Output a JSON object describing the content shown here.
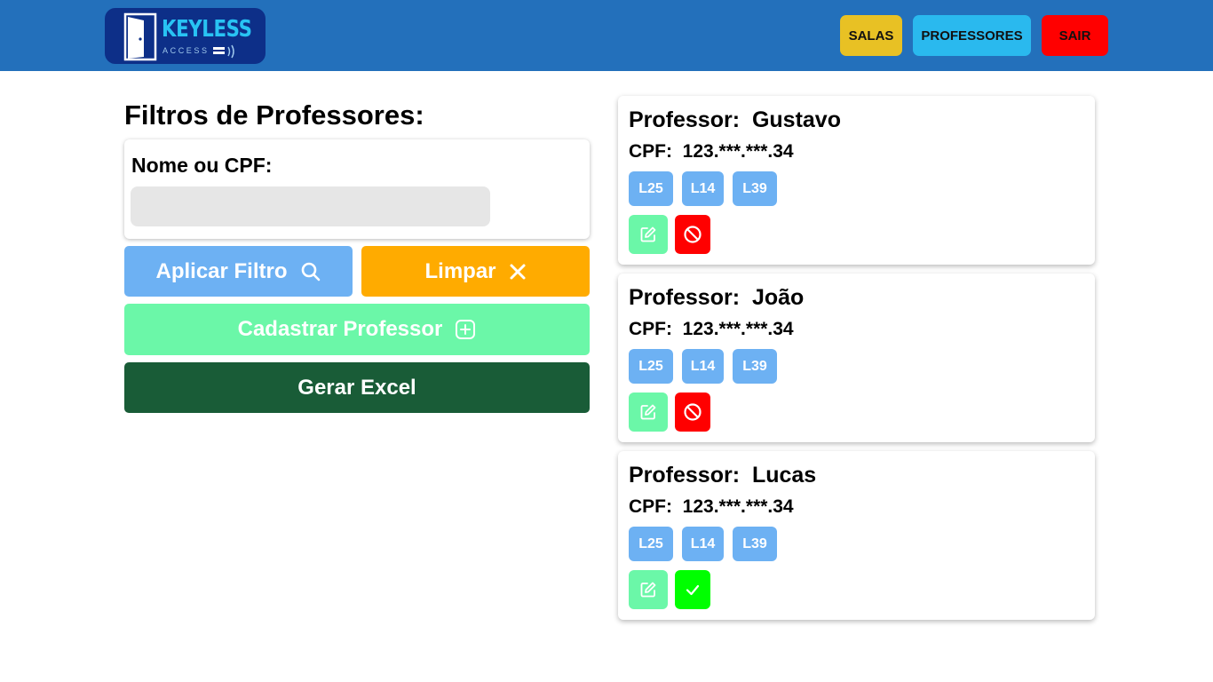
{
  "header": {
    "logo": {
      "brand": "KEYLESS",
      "sub": "ACCESS"
    },
    "nav": [
      {
        "label": "SALAS",
        "color": "#e8c124"
      },
      {
        "label": "PROFESSORES",
        "color": "#2ab9ee"
      },
      {
        "label": "SAIR",
        "color": "#ff0000"
      }
    ],
    "background": "#2370bb"
  },
  "filters": {
    "title": "Filtros de Professores:",
    "field_label": "Nome ou CPF:",
    "field_value": "",
    "apply_label": "Aplicar Filtro",
    "clear_label": "Limpar",
    "register_label": "Cadastrar Professor",
    "excel_label": "Gerar Excel"
  },
  "professors": [
    {
      "name_label": "Professor:",
      "name": "Gustavo",
      "cpf_label": "CPF:",
      "cpf": "123.***.***.34",
      "rooms": [
        "L25",
        "L14",
        "L39"
      ],
      "status": "blocked",
      "status_icon": "block-icon"
    },
    {
      "name_label": "Professor:",
      "name": "João",
      "cpf_label": "CPF:",
      "cpf": "123.***.***.34",
      "rooms": [
        "L25",
        "L14",
        "L39"
      ],
      "status": "blocked",
      "status_icon": "block-icon"
    },
    {
      "name_label": "Professor:",
      "name": "Lucas",
      "cpf_label": "CPF:",
      "cpf": "123.***.***.34",
      "rooms": [
        "L25",
        "L14",
        "L39"
      ],
      "status": "active",
      "status_icon": "check-icon"
    }
  ],
  "colors": {
    "room_badge": "#6db1f3",
    "edit": "#6bf7a8",
    "blocked": "#ff0000",
    "active": "#00ff00",
    "apply": "#6db1f3",
    "clear": "#ffab00",
    "register": "#6bf7a8",
    "excel": "#195c37"
  }
}
